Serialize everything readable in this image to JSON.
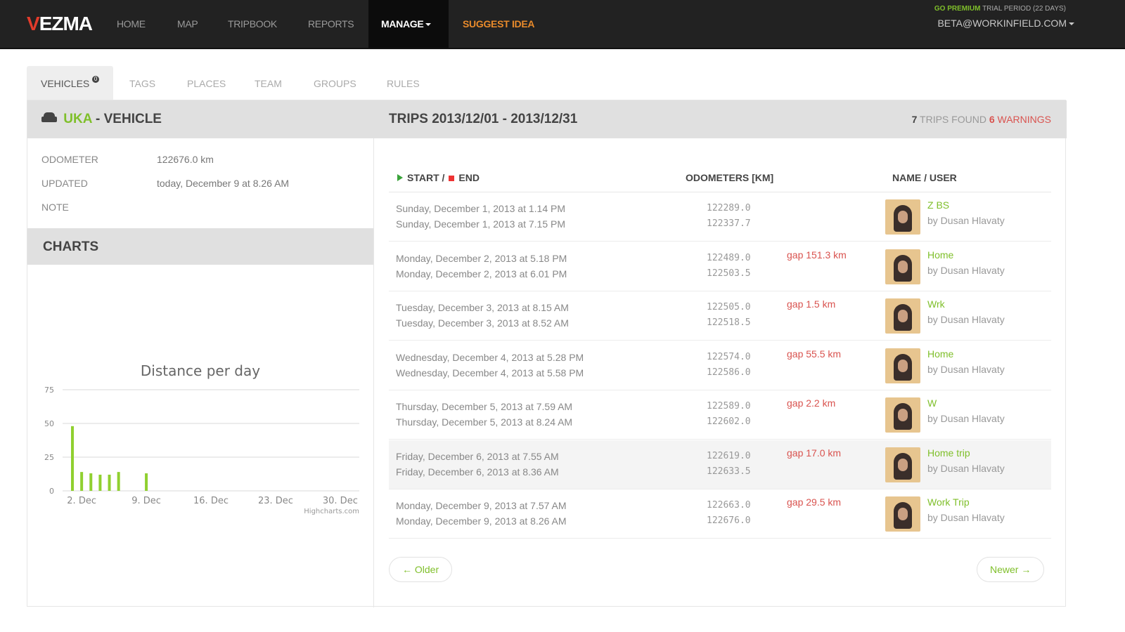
{
  "nav": {
    "logo": "VEZMA",
    "items": [
      "HOME",
      "MAP",
      "TRIPBOOK",
      "REPORTS"
    ],
    "manage": "MANAGE",
    "suggest": "SUGGEST IDEA",
    "premium_label": "GO PREMIUM",
    "trial_text": "TRIAL PERIOD (22 DAYS)",
    "account": "BETA@WORKINFIELD.COM"
  },
  "tabs": {
    "vehicles": "VEHICLES",
    "vehicles_badge": "0",
    "others": [
      "TAGS",
      "PLACES",
      "TEAM",
      "GROUPS",
      "RULES"
    ]
  },
  "vehicle": {
    "name": "UKA",
    "suffix": "- VEHICLE",
    "odometer_label": "ODOMETER",
    "odometer_value": "122676.0 km",
    "updated_label": "UPDATED",
    "updated_value": "today, December 9 at 8.26 AM",
    "note_label": "NOTE"
  },
  "charts": {
    "heading": "CHARTS"
  },
  "trips": {
    "title": "TRIPS 2013/12/01 - 2013/12/31",
    "found_count": "7",
    "found_label": "TRIPS FOUND",
    "warn_count": "6",
    "warn_label": "WARNINGS",
    "col_start": "START /",
    "col_end": "END",
    "col_odo": "ODOMETERS [KM]",
    "col_name": "NAME / USER",
    "rows": [
      {
        "start": "Sunday, December 1, 2013 at 1.14 PM",
        "end": "Sunday, December 1, 2013 at 7.15 PM",
        "odo_start": "122289.0",
        "odo_end": "122337.7",
        "gap": "",
        "name": "Z BS",
        "user": "by Dusan Hlavaty"
      },
      {
        "start": "Monday, December 2, 2013 at 5.18 PM",
        "end": "Monday, December 2, 2013 at 6.01 PM",
        "odo_start": "122489.0",
        "odo_end": "122503.5",
        "gap": "gap 151.3 km",
        "name": "Home",
        "user": "by Dusan Hlavaty"
      },
      {
        "start": "Tuesday, December 3, 2013 at 8.15 AM",
        "end": "Tuesday, December 3, 2013 at 8.52 AM",
        "odo_start": "122505.0",
        "odo_end": "122518.5",
        "gap": "gap 1.5 km",
        "name": "Wrk",
        "user": "by Dusan Hlavaty"
      },
      {
        "start": "Wednesday, December 4, 2013 at 5.28 PM",
        "end": "Wednesday, December 4, 2013 at 5.58 PM",
        "odo_start": "122574.0",
        "odo_end": "122586.0",
        "gap": "gap 55.5 km",
        "name": "Home",
        "user": "by Dusan Hlavaty"
      },
      {
        "start": "Thursday, December 5, 2013 at 7.59 AM",
        "end": "Thursday, December 5, 2013 at 8.24 AM",
        "odo_start": "122589.0",
        "odo_end": "122602.0",
        "gap": "gap 2.2 km",
        "name": "W",
        "user": "by Dusan Hlavaty"
      },
      {
        "start": "Friday, December 6, 2013 at 7.55 AM",
        "end": "Friday, December 6, 2013 at 8.36 AM",
        "odo_start": "122619.0",
        "odo_end": "122633.5",
        "gap": "gap 17.0 km",
        "name": "Home trip",
        "user": "by Dusan Hlavaty"
      },
      {
        "start": "Monday, December 9, 2013 at 7.57 AM",
        "end": "Monday, December 9, 2013 at 8.26 AM",
        "odo_start": "122663.0",
        "odo_end": "122676.0",
        "gap": "gap 29.5 km",
        "name": "Work Trip",
        "user": "by Dusan Hlavaty"
      }
    ],
    "older": "← Older",
    "newer": "Newer →"
  },
  "chart_data": {
    "type": "bar",
    "title": "Distance per day",
    "credit": "Highcharts.com",
    "xlabel": "",
    "ylabel": "",
    "ylim": [
      0,
      75
    ],
    "y_ticks": [
      0,
      25,
      50,
      75
    ],
    "x_ticks": [
      "2. Dec",
      "9. Dec",
      "16. Dec",
      "23. Dec",
      "30. Dec"
    ],
    "x": [
      1,
      2,
      3,
      4,
      5,
      6,
      9
    ],
    "values": [
      48,
      14,
      13,
      12,
      12,
      14,
      13
    ],
    "color": "#90d030",
    "grid": true
  }
}
